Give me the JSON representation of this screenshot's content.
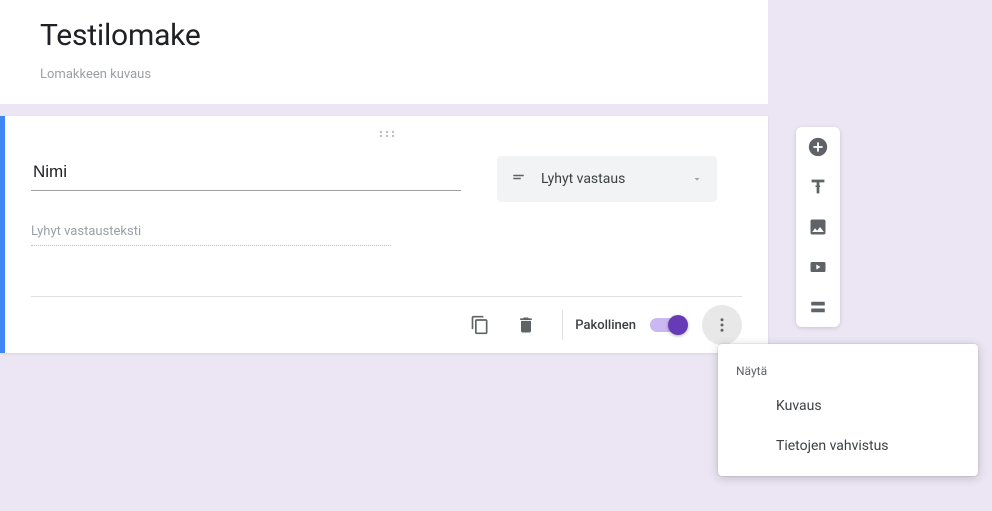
{
  "form": {
    "title": "Testilomake",
    "description": "Lomakkeen kuvaus"
  },
  "question": {
    "title": "Nimi",
    "answer_placeholder": "Lyhyt vastausteksti",
    "type_label": "Lyhyt vastaus",
    "required_label": "Pakollinen",
    "required": true
  },
  "context_menu": {
    "header": "Näytä",
    "items": [
      "Kuvaus",
      "Tietojen vahvistus"
    ]
  },
  "side_tools": {
    "add": "add-circle-icon",
    "text": "title-icon",
    "image": "image-icon",
    "video": "video-icon",
    "section": "section-icon"
  }
}
